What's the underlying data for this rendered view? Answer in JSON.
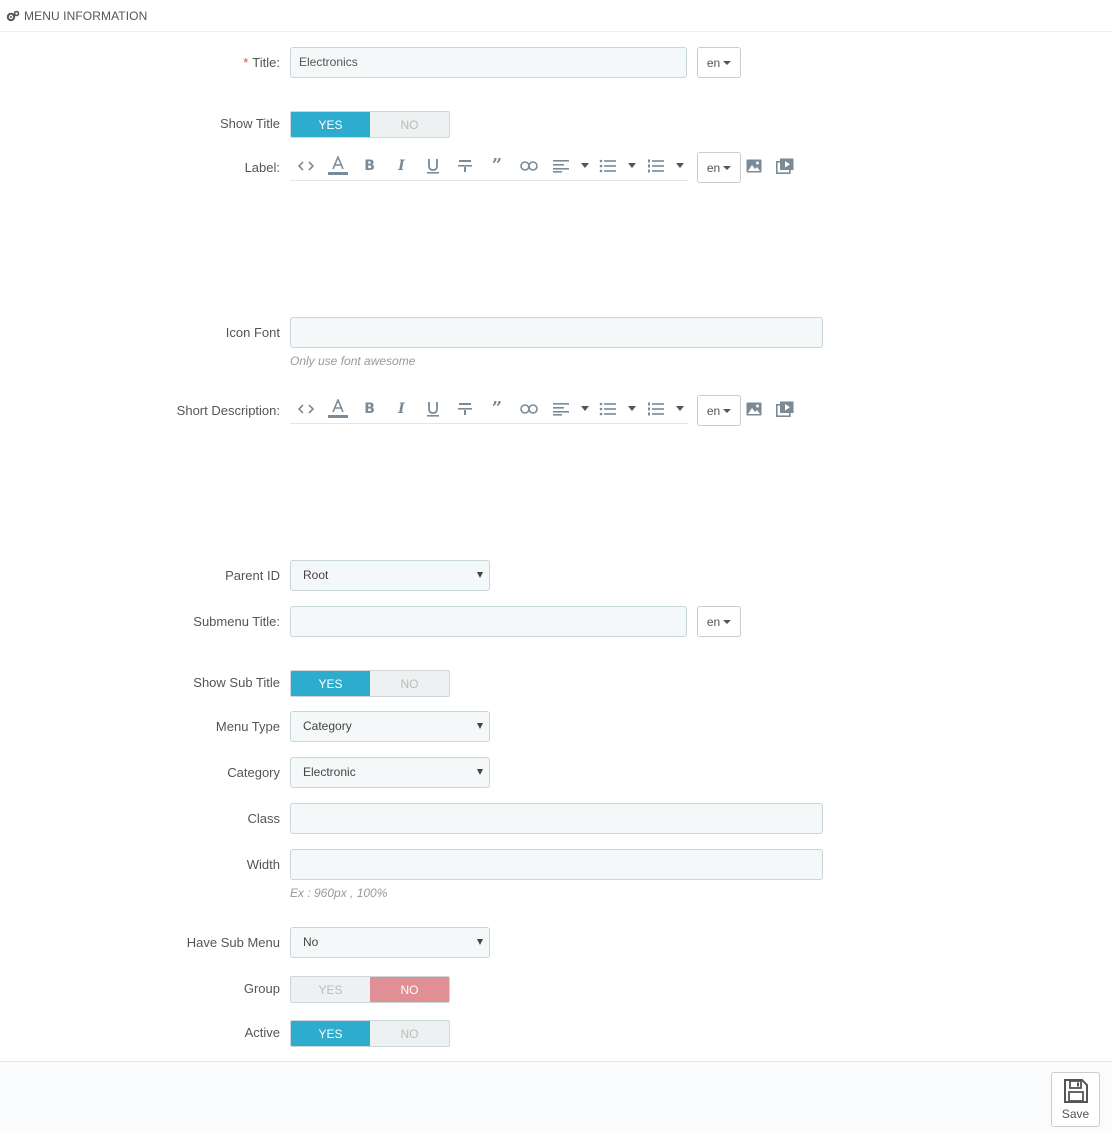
{
  "panel": {
    "title": "MENU INFORMATION",
    "icon": "cogs-icon"
  },
  "title_field": {
    "label": "Title:",
    "required_mark": "*",
    "value": "Electronics",
    "lang": "en"
  },
  "show_title": {
    "label": "Show Title",
    "yes": "YES",
    "no": "NO",
    "selected": "yes"
  },
  "label_field": {
    "label": "Label:",
    "lang": "en",
    "toolbar": [
      "code-view-icon",
      "font-color-icon",
      "bold-icon",
      "italic-icon",
      "underline-icon",
      "strikethrough-icon",
      "quote-icon",
      "link-icon",
      "align-icon",
      "unordered-list-icon",
      "ordered-list-icon",
      "image-icon",
      "video-icon"
    ]
  },
  "icon_font": {
    "label": "Icon Font",
    "value": "",
    "help": "Only use font awesome"
  },
  "short_description": {
    "label": "Short Description:",
    "lang": "en"
  },
  "parent_id": {
    "label": "Parent ID",
    "value": "Root"
  },
  "submenu_title": {
    "label": "Submenu Title:",
    "value": "",
    "lang": "en"
  },
  "show_sub_title": {
    "label": "Show Sub Title",
    "yes": "YES",
    "no": "NO",
    "selected": "yes"
  },
  "menu_type": {
    "label": "Menu Type",
    "value": "Category"
  },
  "category": {
    "label": "Category",
    "value": "Electronic"
  },
  "class_field": {
    "label": "Class",
    "value": ""
  },
  "width_field": {
    "label": "Width",
    "value": "",
    "help": "Ex : 960px , 100%"
  },
  "have_sub_menu": {
    "label": "Have Sub Menu",
    "value": "No"
  },
  "group": {
    "label": "Group",
    "yes": "YES",
    "no": "NO",
    "selected": "no"
  },
  "active": {
    "label": "Active",
    "yes": "YES",
    "no": "NO",
    "selected": "yes"
  },
  "footer": {
    "save_label": "Save"
  },
  "colors": {
    "accent": "#2eacce",
    "no_selected": "#e08f95",
    "required": "#e74c3c"
  }
}
